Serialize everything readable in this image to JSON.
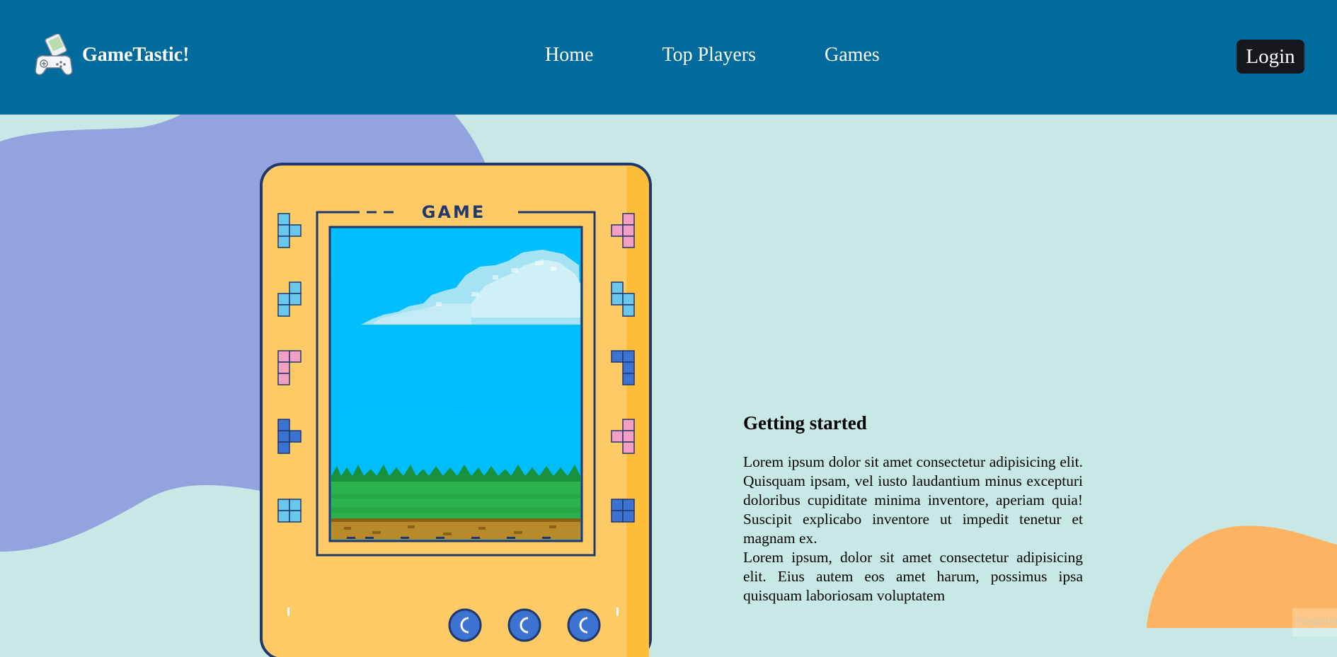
{
  "header": {
    "brand_name": "GameTastic!",
    "nav": [
      {
        "label": "Home"
      },
      {
        "label": "Top Players"
      },
      {
        "label": "Games"
      }
    ],
    "login_label": "Login"
  },
  "console": {
    "label": "GAME"
  },
  "content": {
    "title": "Getting started",
    "paragraph1": "Lorem ipsum dolor sit amet consectetur adipisicing elit. Quisquam ipsam, vel iusto laudantium minus excepturi doloribus cupiditate minima inventore, aperiam quia! Suscipit explicabo inventore ut impedit tenetur et magnam ex.",
    "paragraph2": "Lorem ipsum, dolor sit amet consectetur adipisicing elit. Eius autem eos amet harum, possimus ipsa quisquam laboriosam voluptatem"
  },
  "corner_tab_label": "Register",
  "colors": {
    "header": "#006b9c",
    "background": "#c8e8e6",
    "blob_left": "#93a3dd",
    "blob_right": "#fdb462",
    "console_body": "#fdca66",
    "screen_sky": "#00bfff",
    "login_bg": "#16181d"
  }
}
